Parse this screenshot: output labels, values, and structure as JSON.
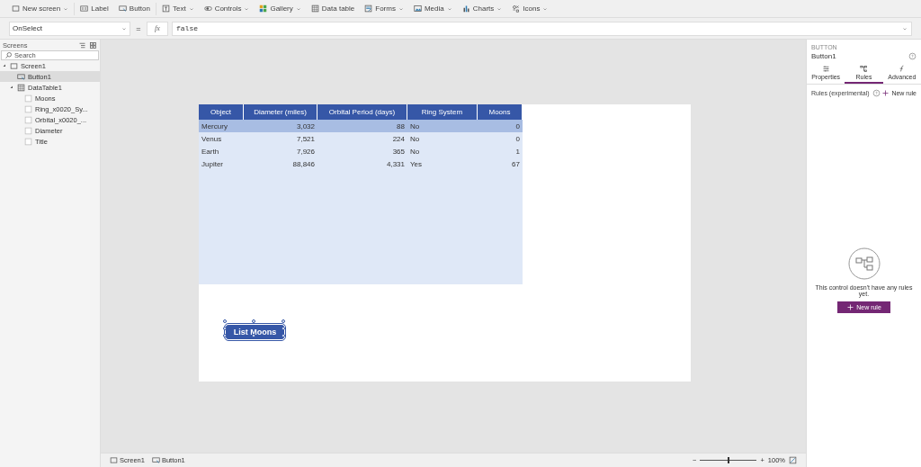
{
  "toolbar": [
    {
      "label": "New screen",
      "kind": "screen",
      "dropdown": true
    },
    {
      "label": "Label",
      "kind": "label",
      "dropdown": false
    },
    {
      "label": "Button",
      "kind": "button",
      "dropdown": false
    },
    {
      "label": "Text",
      "kind": "text",
      "dropdown": true
    },
    {
      "label": "Controls",
      "kind": "toggle",
      "dropdown": true
    },
    {
      "label": "Gallery",
      "kind": "gallery",
      "dropdown": true
    },
    {
      "label": "Data table",
      "kind": "table",
      "dropdown": false
    },
    {
      "label": "Forms",
      "kind": "form",
      "dropdown": true
    },
    {
      "label": "Media",
      "kind": "image",
      "dropdown": true
    },
    {
      "label": "Charts",
      "kind": "chart",
      "dropdown": true
    },
    {
      "label": "Icons",
      "kind": "icons",
      "dropdown": true
    }
  ],
  "formula_bar": {
    "property": "OnSelect",
    "equals": "=",
    "fx": "fx",
    "value": "false"
  },
  "screens_panel": {
    "title": "Screens",
    "search_placeholder": "Search",
    "tree": [
      {
        "label": "Screen1",
        "kind": "screen",
        "expanded": true,
        "selected": false,
        "children": [
          {
            "label": "Button1",
            "kind": "button",
            "selected": true
          },
          {
            "label": "DataTable1",
            "kind": "table",
            "expanded": true,
            "selected": false,
            "children": [
              {
                "label": "Moons",
                "kind": "field",
                "selected": false
              },
              {
                "label": "Ring_x0020_Sy...",
                "kind": "field",
                "selected": false
              },
              {
                "label": "Orbital_x0020_...",
                "kind": "field",
                "selected": false
              },
              {
                "label": "Diameter",
                "kind": "field",
                "selected": false
              },
              {
                "label": "Title",
                "kind": "field",
                "selected": false
              }
            ]
          }
        ]
      }
    ]
  },
  "data_table": {
    "columns": [
      "Object",
      "Diameter (miles)",
      "Orbital Period (days)",
      "Ring System",
      "Moons"
    ],
    "rows": [
      {
        "cells": [
          "Mercury",
          "3,032",
          "88",
          "No",
          "0"
        ],
        "selected": true
      },
      {
        "cells": [
          "Venus",
          "7,521",
          "224",
          "No",
          "0"
        ],
        "selected": false
      },
      {
        "cells": [
          "Earth",
          "7,926",
          "365",
          "No",
          "1"
        ],
        "selected": false
      },
      {
        "cells": [
          "Jupiter",
          "88,846",
          "4,331",
          "Yes",
          "67"
        ],
        "selected": false
      }
    ]
  },
  "canvas_button": {
    "label": "List Moons",
    "selected": true
  },
  "right_panel": {
    "type": "BUTTON",
    "name": "Button1",
    "tabs": [
      {
        "label": "Properties",
        "kind": "sliders",
        "selected": false
      },
      {
        "label": "Rules",
        "kind": "rules",
        "selected": true
      },
      {
        "label": "Advanced",
        "kind": "fx",
        "selected": false
      }
    ],
    "rules_label": "Rules (experimental)",
    "new_rule_link": "New rule",
    "empty_message": "This control doesn't have any rules yet.",
    "new_rule_button": "New rule"
  },
  "status_bar": {
    "breadcrumbs": [
      {
        "label": "Screen1",
        "kind": "screen"
      },
      {
        "label": "Button1",
        "kind": "button"
      }
    ],
    "zoom": {
      "minus": "−",
      "plus": "+",
      "level": 0.5,
      "reading": "100%"
    }
  }
}
